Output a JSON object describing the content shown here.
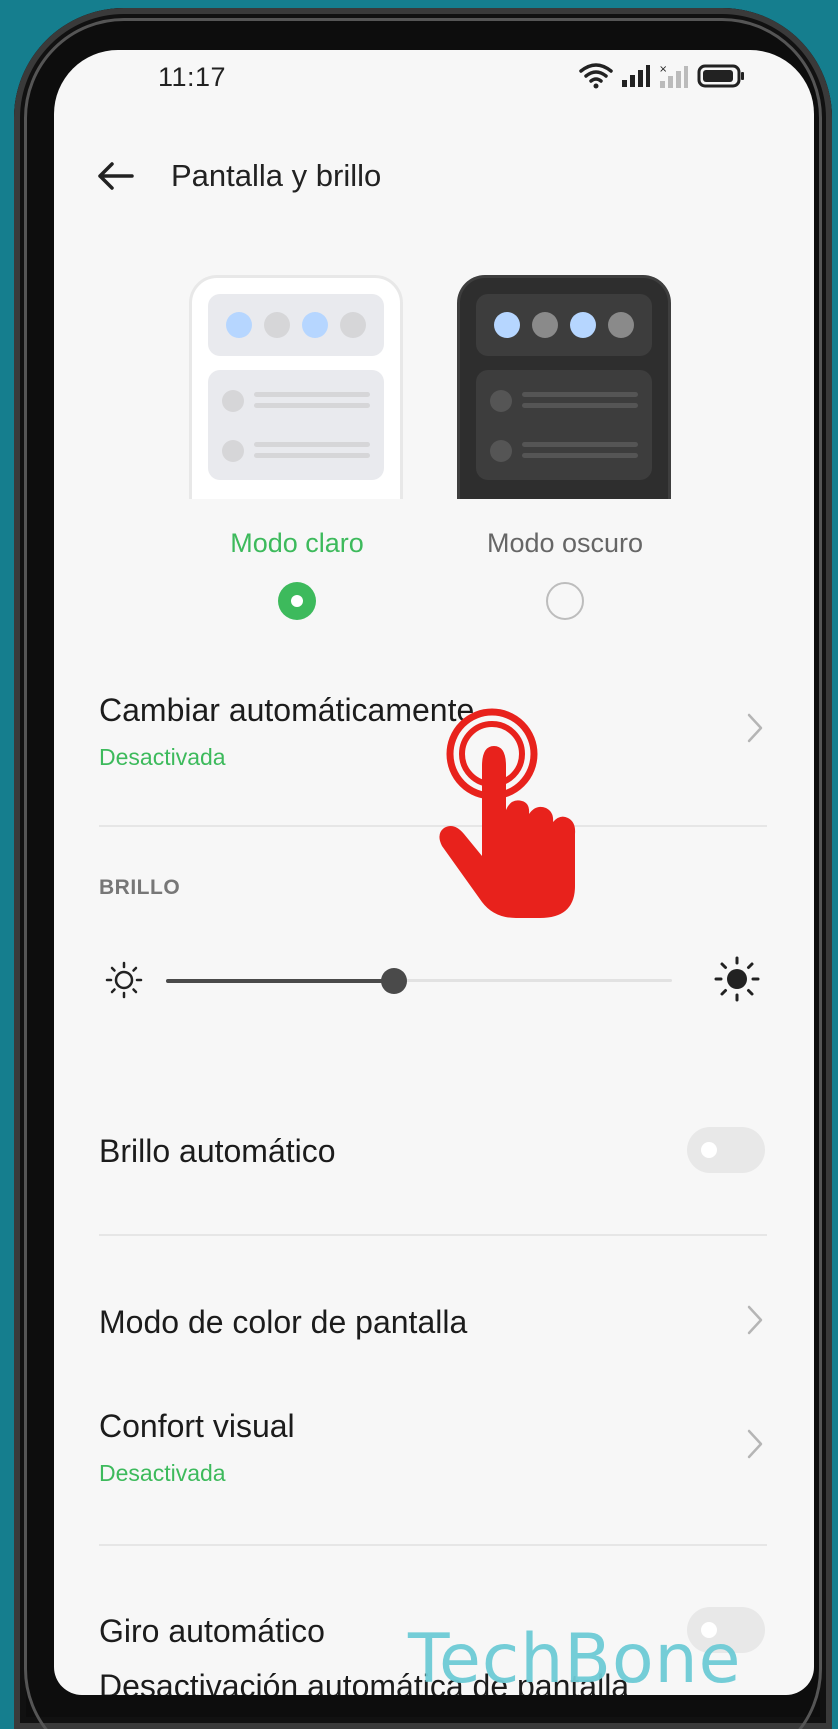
{
  "status_bar": {
    "time": "11:17",
    "icons": [
      "wifi-icon",
      "signal-icon",
      "signal-no-sim-icon",
      "battery-icon"
    ]
  },
  "header": {
    "title": "Pantalla y brillo",
    "back_icon": "arrow-left-icon"
  },
  "theme": {
    "light_label": "Modo claro",
    "dark_label": "Modo oscuro",
    "selected": "light",
    "accent_color": "#3dba5c"
  },
  "auto_switch": {
    "title": "Cambiar automáticamente",
    "status": "Desactivada"
  },
  "brightness": {
    "section_label": "BRILLO",
    "level": 0.45,
    "auto_label": "Brillo automático",
    "auto_enabled": false
  },
  "display_color": {
    "title": "Modo de color de pantalla"
  },
  "eye_comfort": {
    "title": "Confort visual",
    "status": "Desactivada"
  },
  "auto_rotate": {
    "title": "Giro automático",
    "enabled": false
  },
  "screen_timeout": {
    "title": "Desactivación automática de pantalla"
  },
  "overlay": {
    "watermark": "TechBone",
    "tap_indicator_icon": "tap-hand-icon"
  }
}
